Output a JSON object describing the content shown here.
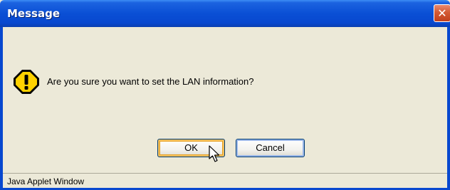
{
  "window": {
    "title": "Message",
    "close_glyph": "✕"
  },
  "dialog": {
    "icon": "warning-icon",
    "message": "Are you sure you want to set the LAN information?",
    "buttons": {
      "ok_label": "OK",
      "cancel_label": "Cancel"
    }
  },
  "status_bar": {
    "text": "Java Applet Window"
  },
  "colors": {
    "titlebar": "#0848cf",
    "background": "#ece9d8",
    "warning_fill": "#ffd200",
    "close_button": "#d35a34"
  }
}
